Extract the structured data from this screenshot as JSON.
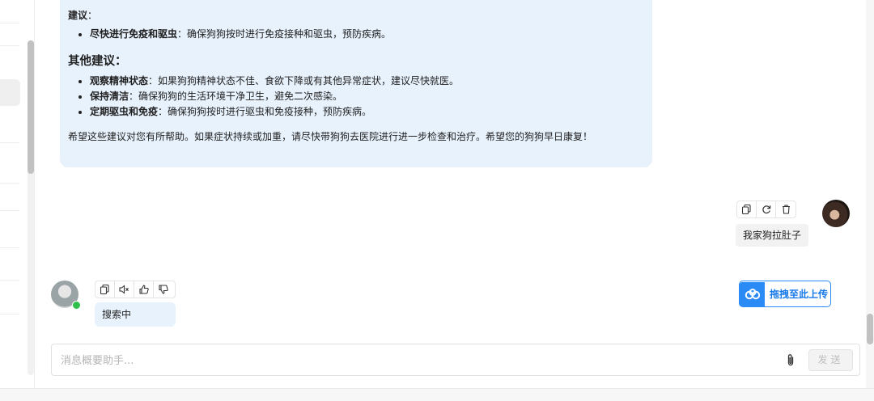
{
  "assistant_message": {
    "intro_label": "建议",
    "intro_colon": "：",
    "items1": [
      {
        "bold": "尽快进行免疫和驱虫",
        "text": "：确保狗狗按时进行免疫接种和驱虫，预防疾病。"
      }
    ],
    "other_heading": "其他建议：",
    "items2": [
      {
        "bold": "观察精神状态",
        "text": "：如果狗狗精神状态不佳、食欲下降或有其他异常症状，建议尽快就医。"
      },
      {
        "bold": "保持清洁",
        "text": "：确保狗狗的生活环境干净卫生，避免二次感染。"
      },
      {
        "bold": "定期驱虫和免疫",
        "text": "：确保狗狗按时进行驱虫和免疫接种，预防疾病。"
      }
    ],
    "closing": "希望这些建议对您有所帮助。如果症状持续或加重，请尽快带狗狗去医院进行进一步检查和治疗。希望您的狗狗早日康复！"
  },
  "user_message": {
    "text": "我家狗拉肚子",
    "actions": [
      "copy-icon",
      "refresh-icon",
      "trash-icon"
    ]
  },
  "bot_reply": {
    "text": "搜索中",
    "actions": [
      "copy-icon",
      "speaker-icon",
      "thumbs-up-icon",
      "thumbs-down-icon"
    ]
  },
  "drag_upload": {
    "label": "拖拽至此上传"
  },
  "composer": {
    "placeholder": "消息概要助手...",
    "send_label": "发送"
  },
  "colors": {
    "bubble_blue": "#e8f2fd",
    "accent": "#2a8af6",
    "online": "#2fbf4a"
  }
}
